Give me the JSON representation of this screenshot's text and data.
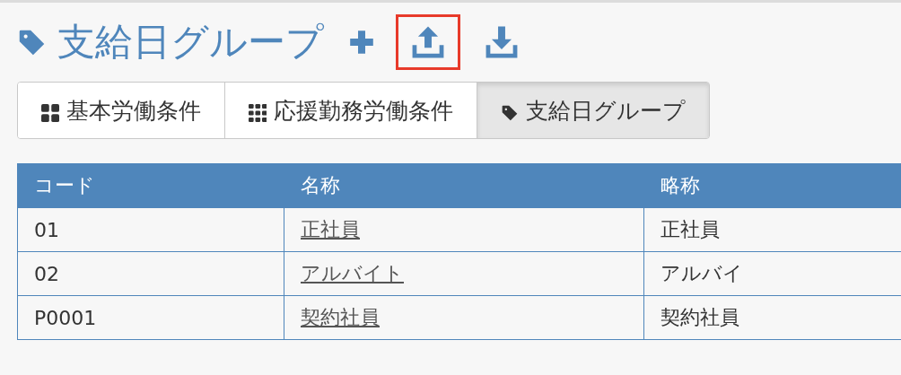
{
  "page": {
    "title": "支給日グループ"
  },
  "actions": [
    {
      "kind": "add",
      "highlighted": false
    },
    {
      "kind": "upload",
      "highlighted": true
    },
    {
      "kind": "download",
      "highlighted": false
    }
  ],
  "tabs": [
    {
      "label": "基本労働条件",
      "kind": "grid4",
      "selected": false
    },
    {
      "label": "応援勤務労働条件",
      "kind": "grid9",
      "selected": false
    },
    {
      "label": "支給日グループ",
      "kind": "tag",
      "selected": true
    }
  ],
  "table": {
    "columns": [
      "コード",
      "名称",
      "略称"
    ],
    "rows": [
      {
        "code": "01",
        "name": "正社員",
        "short": "正社員"
      },
      {
        "code": "02",
        "name": "アルバイト",
        "short": "アルバイ"
      },
      {
        "code": "P0001",
        "name": "契約社員",
        "short": "契約社員"
      }
    ]
  }
}
